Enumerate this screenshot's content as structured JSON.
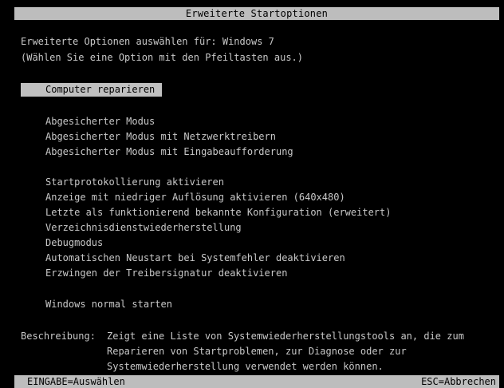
{
  "title": "Erweiterte Startoptionen",
  "header": {
    "line1": "Erweiterte Optionen auswählen für: Windows 7",
    "line2": "(Wählen Sie eine Option mit den Pfeiltasten aus.)"
  },
  "options": {
    "selected": "Computer reparieren",
    "group1": [
      "Abgesicherter Modus",
      "Abgesicherter Modus mit Netzwerktreibern",
      "Abgesicherter Modus mit Eingabeaufforderung"
    ],
    "group2": [
      "Startprotokollierung aktivieren",
      "Anzeige mit niedriger Auflösung aktivieren (640x480)",
      "Letzte als funktionierend bekannte Konfiguration (erweitert)",
      "Verzeichnisdienstwiederherstellung",
      "Debugmodus",
      "Automatischen Neustart bei Systemfehler deaktivieren",
      "Erzwingen der Treibersignatur deaktivieren"
    ],
    "normal": "Windows normal starten"
  },
  "description": {
    "label": "Beschreibung:",
    "lines": [
      "Zeigt eine Liste von Systemwiederherstellungstools an, die zum",
      "Reparieren von Startproblemen, zur Diagnose oder zur",
      "Systemwiederherstellung verwendet werden können."
    ]
  },
  "footer": {
    "left": "EINGABE=Auswählen",
    "right": "ESC=Abbrechen"
  },
  "colors": {
    "background": "#000000",
    "text": "#c8c8c8",
    "highlight": "#bdbdbd"
  }
}
